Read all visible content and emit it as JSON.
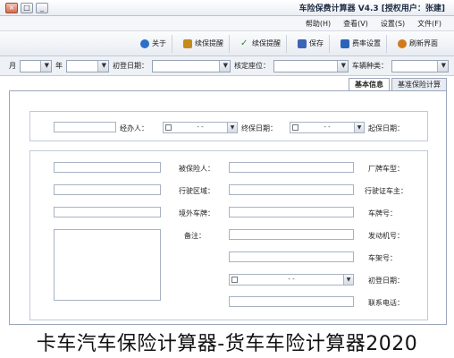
{
  "window": {
    "title": "车险保费计算器 V4.3 [授权用户：张建]",
    "controls": [
      "×",
      "□",
      "_"
    ]
  },
  "menu": [
    "文件(F)",
    "设置(S)",
    "查看(V)",
    "帮助(H)"
  ],
  "toolbar": {
    "buttons": [
      {
        "label": "关于",
        "icon": "info-icon",
        "color": "#2d6ec9"
      },
      {
        "label": "续保提醒",
        "icon": "bell-icon",
        "color": "#c48a1c"
      },
      {
        "label": "续保提醒",
        "icon": "check-icon",
        "color": "#2f8a3a"
      },
      {
        "label": "保存",
        "icon": "save-icon",
        "color": "#3b64b5"
      },
      {
        "label": "费率设置",
        "icon": "settings-icon",
        "color": "#2a64b8"
      },
      {
        "label": "刷新界面",
        "icon": "refresh-icon",
        "color": "#d17a1c"
      }
    ]
  },
  "filter": {
    "car_type_label": "车辆种类：",
    "seat_label": "核定座位：",
    "reg_date_label": "初登日期：",
    "year_label": "年",
    "month_label": "月"
  },
  "tabs": [
    "基本信息",
    "基准保险计算"
  ],
  "insurance_dates": {
    "start_label": "起保日期：",
    "end_label": "终保日期：",
    "start_value": "- -",
    "end_value": "- -",
    "agent_label": "经办人："
  },
  "fields_left": [
    "厂牌车型：",
    "行驶证车主：",
    "车牌号：",
    "发动机号：",
    "车架号：",
    "初登日期：",
    "联系电话："
  ],
  "fields_right": [
    "被保险人：",
    "行驶区域：",
    "境外车牌："
  ],
  "remark_label": "备注：",
  "first_reg_date_value": "- -",
  "caption": "卡车汽车保险计算器-货车车险计算器2020"
}
